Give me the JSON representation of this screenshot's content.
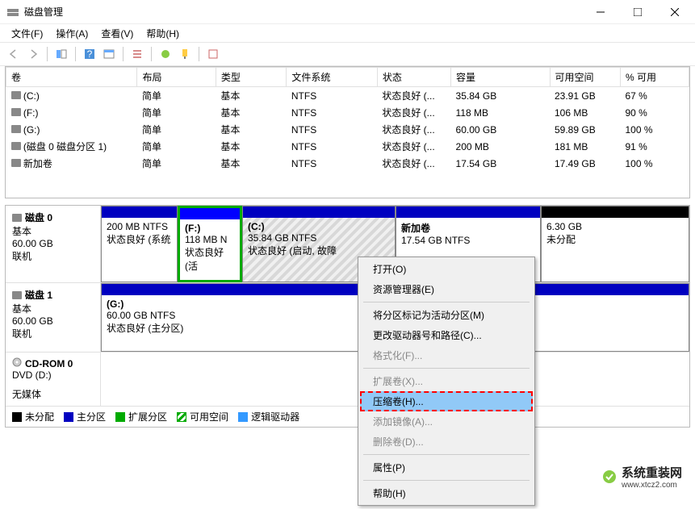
{
  "window": {
    "title": "磁盘管理"
  },
  "menu": {
    "file": "文件(F)",
    "action": "操作(A)",
    "view": "查看(V)",
    "help": "帮助(H)"
  },
  "columns": {
    "volume": "卷",
    "layout": "布局",
    "type": "类型",
    "fs": "文件系统",
    "status": "状态",
    "capacity": "容量",
    "free": "可用空间",
    "pct": "% 可用"
  },
  "volumes": [
    {
      "name": "(C:)",
      "layout": "简单",
      "type": "基本",
      "fs": "NTFS",
      "status": "状态良好 (...",
      "capacity": "35.84 GB",
      "free": "23.91 GB",
      "pct": "67 %"
    },
    {
      "name": "(F:)",
      "layout": "简单",
      "type": "基本",
      "fs": "NTFS",
      "status": "状态良好 (...",
      "capacity": "118 MB",
      "free": "106 MB",
      "pct": "90 %"
    },
    {
      "name": "(G:)",
      "layout": "简单",
      "type": "基本",
      "fs": "NTFS",
      "status": "状态良好 (...",
      "capacity": "60.00 GB",
      "free": "59.89 GB",
      "pct": "100 %"
    },
    {
      "name": "(磁盘 0 磁盘分区 1)",
      "layout": "简单",
      "type": "基本",
      "fs": "NTFS",
      "status": "状态良好 (...",
      "capacity": "200 MB",
      "free": "181 MB",
      "pct": "91 %"
    },
    {
      "name": "新加卷",
      "layout": "简单",
      "type": "基本",
      "fs": "NTFS",
      "status": "状态良好 (...",
      "capacity": "17.54 GB",
      "free": "17.49 GB",
      "pct": "100 %"
    }
  ],
  "disk0": {
    "label": "磁盘 0",
    "type": "基本",
    "size": "60.00 GB",
    "status": "联机",
    "parts": [
      {
        "line1": "",
        "line2": "200 MB NTFS",
        "line3": "状态良好 (系统"
      },
      {
        "line1": "(F:)",
        "line2": "118 MB N",
        "line3": "状态良好 (活"
      },
      {
        "line1": "(C:)",
        "line2": "35.84 GB NTFS",
        "line3": "状态良好 (启动, 故障"
      },
      {
        "line1": "新加卷",
        "line2": "17.54 GB NTFS",
        "line3": ""
      },
      {
        "line1": "",
        "line2": "6.30 GB",
        "line3": "未分配"
      }
    ]
  },
  "disk1": {
    "label": "磁盘 1",
    "type": "基本",
    "size": "60.00 GB",
    "status": "联机",
    "parts": [
      {
        "line1": "(G:)",
        "line2": "60.00 GB NTFS",
        "line3": "状态良好 (主分区)"
      }
    ]
  },
  "cdrom": {
    "label": "CD-ROM 0",
    "type": "DVD (D:)",
    "status": "无媒体"
  },
  "legend": {
    "unalloc": "未分配",
    "primary": "主分区",
    "extended": "扩展分区",
    "free": "可用空间",
    "logical": "逻辑驱动器"
  },
  "ctx": {
    "open": "打开(O)",
    "explorer": "资源管理器(E)",
    "mark_active": "将分区标记为活动分区(M)",
    "change_letter": "更改驱动器号和路径(C)...",
    "format": "格式化(F)...",
    "extend": "扩展卷(X)...",
    "shrink": "压缩卷(H)...",
    "add_mirror": "添加镜像(A)...",
    "delete": "删除卷(D)...",
    "properties": "属性(P)",
    "help": "帮助(H)"
  },
  "watermark": {
    "text": "系统重装网",
    "url": "www.xtcz2.com"
  }
}
